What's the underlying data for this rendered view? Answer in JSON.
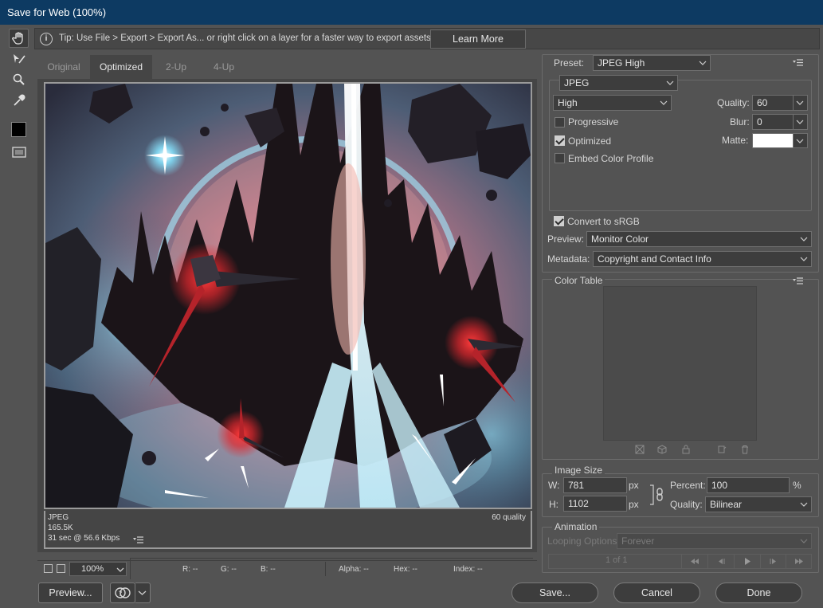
{
  "title": "Save for Web (100%)",
  "tip": {
    "text": "Tip: Use File > Export > Export As...  or right click on a layer for a faster way to export assets",
    "button": "Learn More"
  },
  "tabs": [
    "Original",
    "Optimized",
    "2-Up",
    "4-Up"
  ],
  "preview": {
    "format": "JPEG",
    "size": "165.5K",
    "time": "31 sec @ 56.6 Kbps",
    "quality": "60 quality"
  },
  "zoom": "100%",
  "status": {
    "r": "R: --",
    "g": "G: --",
    "b": "B: --",
    "alpha": "Alpha: --",
    "hex": "Hex: --",
    "index": "Index: --"
  },
  "buttons": {
    "preview": "Preview...",
    "save": "Save...",
    "cancel": "Cancel",
    "done": "Done"
  },
  "settings": {
    "preset_label": "Preset:",
    "preset": "JPEG High",
    "format": "JPEG",
    "quality_level": "High",
    "quality_label": "Quality:",
    "quality": "60",
    "blur_label": "Blur:",
    "blur": "0",
    "matte_label": "Matte:",
    "progressive": "Progressive",
    "optimized": "Optimized",
    "embed_profile": "Embed Color Profile",
    "convert_srgb": "Convert to sRGB",
    "preview_label": "Preview:",
    "preview_value": "Monitor Color",
    "metadata_label": "Metadata:",
    "metadata_value": "Copyright and Contact Info"
  },
  "checks": {
    "progressive": false,
    "optimized": true,
    "embed_profile": false,
    "convert_srgb": true
  },
  "color_table": {
    "title": "Color Table"
  },
  "image_size": {
    "title": "Image Size",
    "w_label": "W:",
    "w": "781",
    "h_label": "H:",
    "h": "1102",
    "unit": "px",
    "percent_label": "Percent:",
    "percent": "100",
    "percent_unit": "%",
    "quality_label": "Quality:",
    "quality": "Bilinear"
  },
  "animation": {
    "title": "Animation",
    "looping_label": "Looping Options:",
    "looping": "Forever",
    "frame": "1 of 1"
  },
  "colors": {
    "titlebar": "#0d3a62",
    "panel": "#535353",
    "accent_red": "#e0282e",
    "glow_blue": "#9fdcf0"
  }
}
